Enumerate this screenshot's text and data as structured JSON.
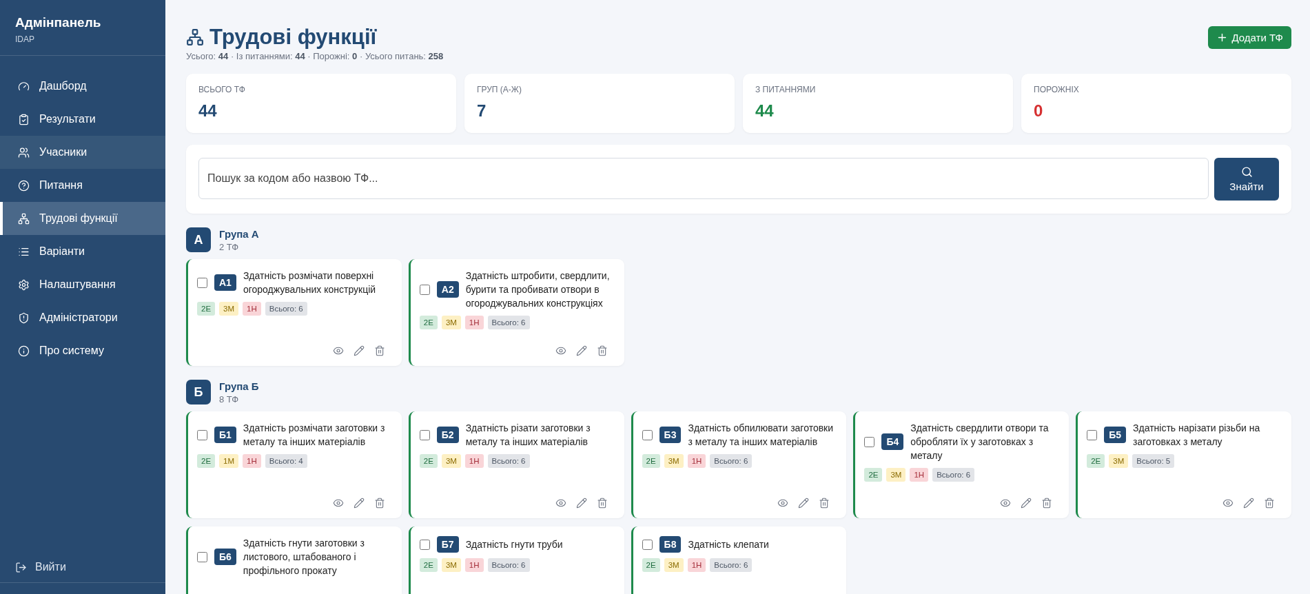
{
  "sidebar": {
    "title": "Адмінпанель",
    "subtitle": "IDAP",
    "items": [
      {
        "label": "Дашборд",
        "selected": false,
        "hovered": false
      },
      {
        "label": "Результати",
        "selected": false,
        "hovered": false
      },
      {
        "label": "Учасники",
        "selected": false,
        "hovered": true
      },
      {
        "label": "Питання",
        "selected": false,
        "hovered": false
      },
      {
        "label": "Трудові функції",
        "selected": true,
        "hovered": false
      },
      {
        "label": "Варіанти",
        "selected": false,
        "hovered": false
      },
      {
        "label": "Налаштування",
        "selected": false,
        "hovered": false
      },
      {
        "label": "Адміністратори",
        "selected": false,
        "hovered": false
      },
      {
        "label": "Про систему",
        "selected": false,
        "hovered": false
      }
    ],
    "logout": "Вийти"
  },
  "header": {
    "title": "Трудові функції",
    "summary": "Усього: **44** · Із питаннями: **44** · Порожні: **0** · Усього питань: **258**",
    "add_button": "Додати ТФ"
  },
  "stats": [
    {
      "label": "ВСЬОГО ТФ",
      "value": "44",
      "color": "#234a73"
    },
    {
      "label": "ГРУП (А-Ж)",
      "value": "7",
      "color": "#234a73"
    },
    {
      "label": "З ПИТАННЯМИ",
      "value": "44",
      "color": "#1e8a4c"
    },
    {
      "label": "ПОРОЖНІХ",
      "value": "0",
      "color": "#d63031"
    }
  ],
  "search": {
    "placeholder": "Пошук за кодом або назвою ТФ...",
    "button": "Знайти"
  },
  "groups": [
    {
      "letter": "А",
      "title": "Група А",
      "count": "2 ТФ",
      "items": [
        {
          "code": "А1",
          "title": "Здатність розмічати поверхні огороджувальних конструкцій",
          "checked": false,
          "tags": [
            {
              "kind": "e",
              "text": "2Е"
            },
            {
              "kind": "m",
              "text": "3М"
            },
            {
              "kind": "h",
              "text": "1Н"
            },
            {
              "kind": "total",
              "text": "Всього: 6"
            }
          ]
        },
        {
          "code": "А2",
          "title": "Здатність штробити, свердлити, бурити та пробивати отвори в огороджувальних конструкціях",
          "checked": false,
          "tags": [
            {
              "kind": "e",
              "text": "2Е"
            },
            {
              "kind": "m",
              "text": "3М"
            },
            {
              "kind": "h",
              "text": "1Н"
            },
            {
              "kind": "total",
              "text": "Всього: 6"
            }
          ]
        }
      ]
    },
    {
      "letter": "Б",
      "title": "Група Б",
      "count": "8 ТФ",
      "items": [
        {
          "code": "Б1",
          "title": "Здатність розмічати заготовки з металу та інших матеріалів",
          "checked": false,
          "tags": [
            {
              "kind": "e",
              "text": "2Е"
            },
            {
              "kind": "m",
              "text": "1М"
            },
            {
              "kind": "h",
              "text": "1Н"
            },
            {
              "kind": "total",
              "text": "Всього: 4"
            }
          ]
        },
        {
          "code": "Б2",
          "title": "Здатність різати заготовки з металу та інших матеріалів",
          "checked": false,
          "tags": [
            {
              "kind": "e",
              "text": "2Е"
            },
            {
              "kind": "m",
              "text": "3М"
            },
            {
              "kind": "h",
              "text": "1Н"
            },
            {
              "kind": "total",
              "text": "Всього: 6"
            }
          ]
        },
        {
          "code": "Б3",
          "title": "Здатність обпилювати заготовки з металу та інших матеріалів",
          "checked": false,
          "tags": [
            {
              "kind": "e",
              "text": "2Е"
            },
            {
              "kind": "m",
              "text": "3М"
            },
            {
              "kind": "h",
              "text": "1Н"
            },
            {
              "kind": "total",
              "text": "Всього: 6"
            }
          ]
        },
        {
          "code": "Б4",
          "title": "Здатність свердлити отвори та обробляти їх у заготовках з металу",
          "checked": false,
          "tags": [
            {
              "kind": "e",
              "text": "2Е"
            },
            {
              "kind": "m",
              "text": "3М"
            },
            {
              "kind": "h",
              "text": "1Н"
            },
            {
              "kind": "total",
              "text": "Всього: 6"
            }
          ]
        },
        {
          "code": "Б5",
          "title": "Здатність нарізати різьби на заготовках з металу",
          "checked": false,
          "tags": [
            {
              "kind": "e",
              "text": "2Е"
            },
            {
              "kind": "m",
              "text": "3М"
            },
            {
              "kind": "total",
              "text": "Всього: 5"
            }
          ]
        },
        {
          "code": "Б6",
          "title": "Здатність гнути заготовки з листового, штабованого і профільного прокату",
          "checked": false,
          "actions_shown": false
        },
        {
          "code": "Б7",
          "title": "Здатність гнути труби",
          "checked": false,
          "actions_shown": false,
          "tags": [
            {
              "kind": "e",
              "text": "2Е"
            },
            {
              "kind": "m",
              "text": "3М"
            },
            {
              "kind": "h",
              "text": "1Н"
            },
            {
              "kind": "total",
              "text": "Всього: 6"
            }
          ]
        },
        {
          "code": "Б8",
          "title": "Здатність клепати",
          "checked": false,
          "actions_shown": false,
          "tags": [
            {
              "kind": "e",
              "text": "2Е"
            },
            {
              "kind": "m",
              "text": "3М"
            },
            {
              "kind": "h",
              "text": "1Н"
            },
            {
              "kind": "total",
              "text": "Всього: 6"
            }
          ]
        }
      ]
    }
  ]
}
